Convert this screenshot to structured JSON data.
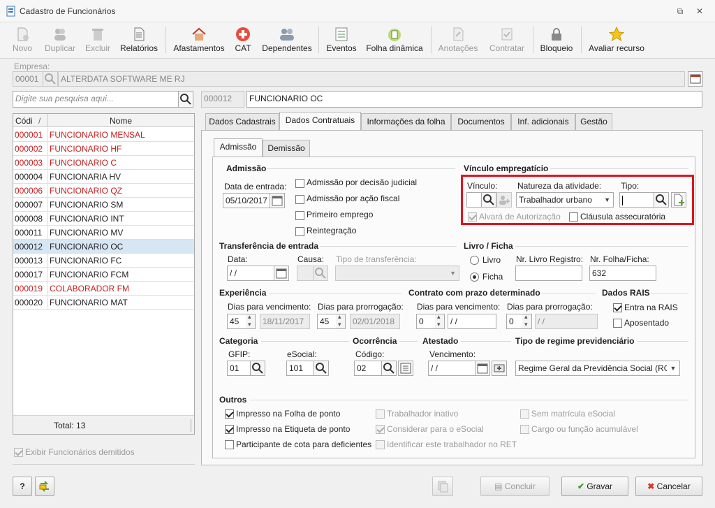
{
  "window": {
    "title": "Cadastro de Funcionários"
  },
  "toolbar": {
    "novo": "Novo",
    "duplicar": "Duplicar",
    "excluir": "Excluir",
    "relatorios": "Relatórios",
    "afastamentos": "Afastamentos",
    "cat": "CAT",
    "dependentes": "Dependentes",
    "eventos": "Eventos",
    "folha_dinamica": "Folha dinâmica",
    "anotacoes": "Anotações",
    "contratar": "Contratar",
    "bloqueio": "Bloqueio",
    "avaliar_recurso": "Avaliar recurso"
  },
  "empresa": {
    "label": "Empresa:",
    "code": "00001",
    "name": "ALTERDATA SOFTWARE ME RJ"
  },
  "search": {
    "placeholder": "Digite sua pesquisa aqui..."
  },
  "current": {
    "code": "000012",
    "name": "FUNCIONARIO OC"
  },
  "list": {
    "col_code": "Códi",
    "col_name": "Nome",
    "sort_glyph": "/",
    "rows": [
      {
        "code": "000001",
        "name": "FUNCIONARIO MENSAL"
      },
      {
        "code": "000002",
        "name": "FUNCIONARIO HF"
      },
      {
        "code": "000003",
        "name": "FUNCIONARIO C"
      },
      {
        "code": "000004",
        "name": "FUNCIONARIA HV"
      },
      {
        "code": "000006",
        "name": "FUNCIONARIO QZ"
      },
      {
        "code": "000007",
        "name": "FUNCIONARIO SM"
      },
      {
        "code": "000008",
        "name": "FUNCIONARIO INT"
      },
      {
        "code": "000011",
        "name": "FUNCIONARIO MV"
      },
      {
        "code": "000012",
        "name": "FUNCIONARIO OC"
      },
      {
        "code": "000013",
        "name": "FUNCIONARIO FC"
      },
      {
        "code": "000017",
        "name": "FUNCIONARIO FCM"
      },
      {
        "code": "000019",
        "name": "COLABORADOR FM"
      },
      {
        "code": "000020",
        "name": "FUNCIONARIO MAT"
      }
    ],
    "total": "Total: 13",
    "show_dismissed": "Exibir Funcionários demitidos"
  },
  "tabs": [
    "Dados Cadastrais",
    "Dados Contratuais",
    "Informações da folha",
    "Documentos",
    "Inf. adicionais",
    "Gestão"
  ],
  "subtabs": [
    "Admissão",
    "Demissão"
  ],
  "admissao": {
    "title": "Admissão",
    "data_label": "Data de entrada:",
    "data_value": "05/10/2017",
    "cb1": "Admissão por decisão judicial",
    "cb2": "Admissão por ação fiscal",
    "cb3": "Primeiro emprego",
    "cb4": "Reintegração"
  },
  "vinculo": {
    "title": "Vínculo empregatício",
    "vinculo_label": "Vínculo:",
    "natureza_label": "Natureza da atividade:",
    "natureza_value": "Trabalhador urbano",
    "tipo_label": "Tipo:",
    "alvara": "Alvará de Autorização",
    "clausula": "Cláusula assecuratória"
  },
  "transferencia": {
    "title": "Transferência de entrada",
    "data_label": "Data:",
    "data_value": " /  /",
    "causa_label": "Causa:",
    "tipo_label": "Tipo de transferência:"
  },
  "livro": {
    "title": "Livro / Ficha",
    "livro": "Livro",
    "ficha": "Ficha",
    "nr_livro_label": "Nr. Livro Registro:",
    "nr_folha_label": "Nr. Folha/Ficha:",
    "nr_folha_value": "632"
  },
  "experiencia": {
    "title": "Experiência",
    "venc_label": "Dias para vencimento:",
    "venc_value": "45",
    "venc_date": "18/11/2017",
    "prorr_label": "Dias para prorrogação:",
    "prorr_value": "45",
    "prorr_date": "02/01/2018"
  },
  "contrato": {
    "title": "Contrato com prazo determinado",
    "venc_label": "Dias para vencimento:",
    "venc_value": "0",
    "venc_date": " /  /",
    "prorr_label": "Dias para prorrogação:",
    "prorr_value": "0",
    "prorr_date": " /  /"
  },
  "rais": {
    "title": "Dados RAIS",
    "entra": "Entra na RAIS",
    "aposentado": "Aposentado"
  },
  "categoria": {
    "title": "Categoria",
    "gfip_label": "GFIP:",
    "gfip_value": "01",
    "esocial_label": "eSocial:",
    "esocial_value": "101"
  },
  "ocorrencia": {
    "title": "Ocorrência",
    "codigo_label": "Código:",
    "codigo_value": "02"
  },
  "atestado": {
    "title": "Atestado",
    "venc_label": "Vencimento:",
    "venc_value": " /  /"
  },
  "regime": {
    "title": "Tipo de regime previdenciário",
    "value": "Regime Geral da Previdência Social (RGP"
  },
  "outros": {
    "title": "Outros",
    "folha_ponto": "Impresso na Folha de ponto",
    "etiqueta_ponto": "Impresso na Etiqueta de ponto",
    "cota": "Participante de cota para deficientes",
    "inativo": "Trabalhador inativo",
    "considerar": "Considerar para o eSocial",
    "identificar": "Identificar este trabalhador no RET",
    "sem_matricula": "Sem matrícula eSocial",
    "cargo": "Cargo ou função acumulável"
  },
  "footer": {
    "help": "?",
    "concluir": "Concluir",
    "gravar": "Gravar",
    "cancelar": "Cancelar"
  },
  "colors": {
    "red_text": "#c81e1e",
    "highlight": "#e1141e",
    "selected_row": "#d7e6f3"
  }
}
